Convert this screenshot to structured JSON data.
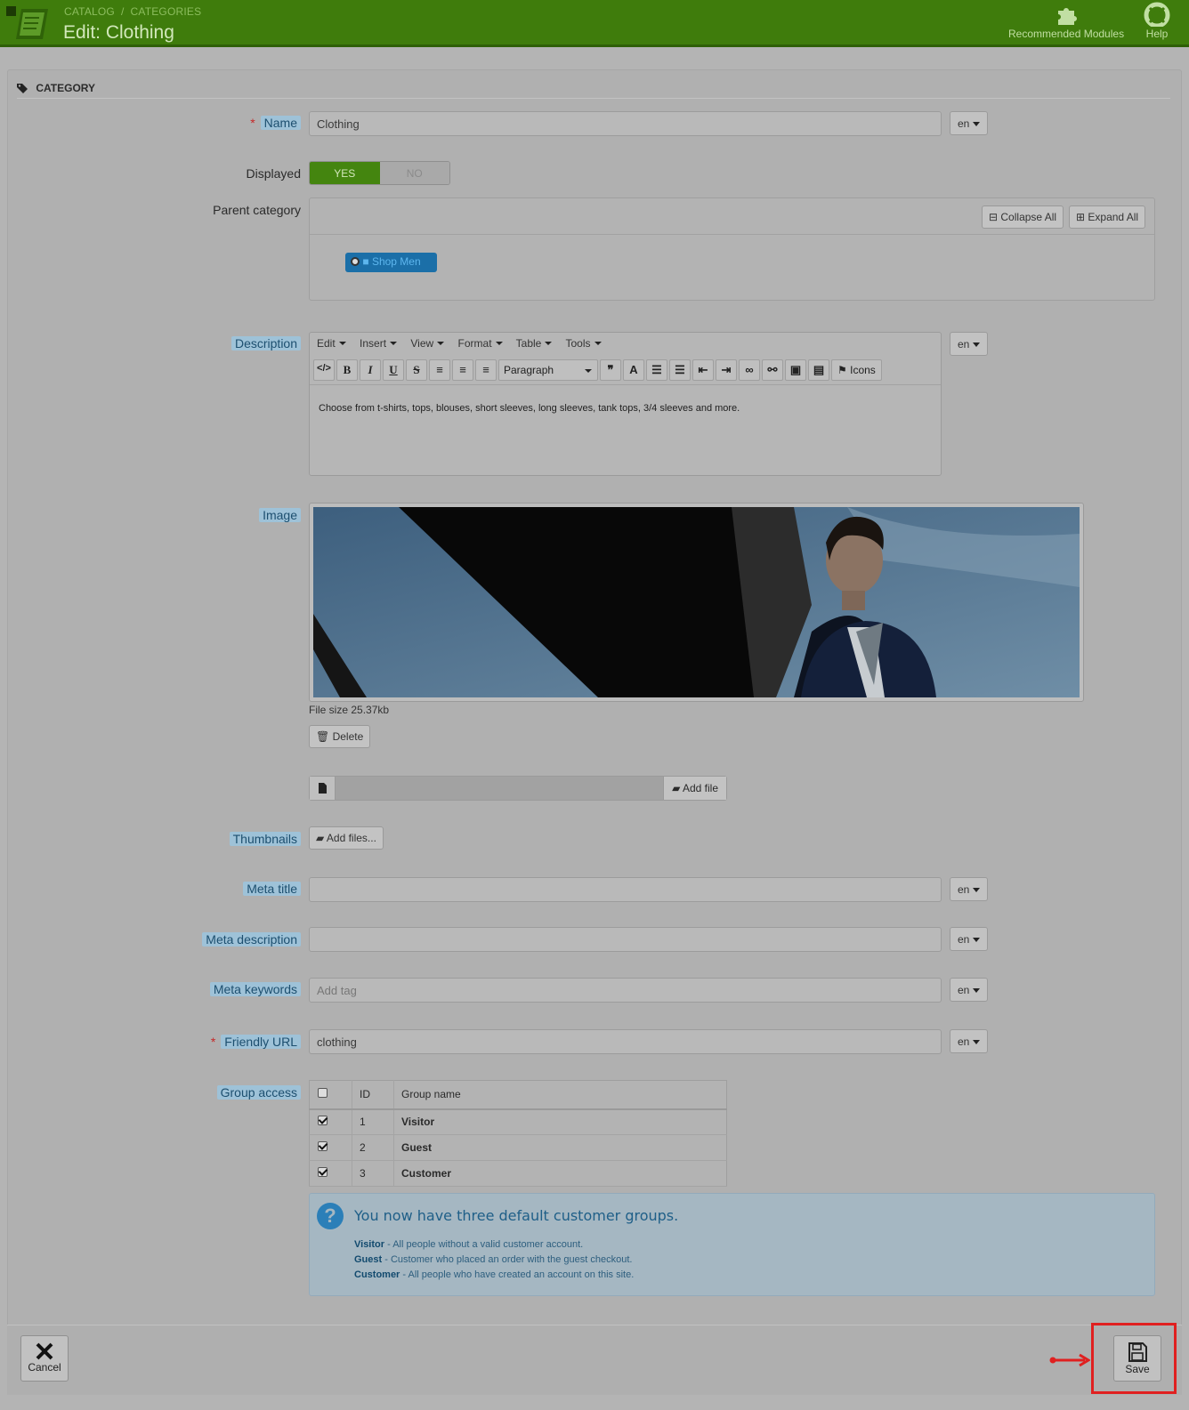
{
  "header": {
    "breadcrumb": [
      "CATALOG",
      "CATEGORIES"
    ],
    "breadcrumb_sep": "/",
    "title": "Edit: Clothing",
    "recommended_label": "Recommended Modules",
    "help_label": "Help"
  },
  "panel": {
    "heading": "CATEGORY"
  },
  "form": {
    "name": {
      "label": "Name",
      "value": "Clothing",
      "lang": "en"
    },
    "displayed": {
      "label": "Displayed",
      "yes": "YES",
      "no": "NO",
      "value": true
    },
    "parent": {
      "label": "Parent category",
      "collapse": "Collapse All",
      "expand": "Expand All",
      "node": "Shop Men"
    },
    "description": {
      "label": "Description",
      "lang": "en",
      "menus": [
        "Edit",
        "Insert",
        "View",
        "Format",
        "Table",
        "Tools"
      ],
      "format_select": "Paragraph",
      "icons_btn": "Icons",
      "content": "Choose from t-shirts, tops, blouses, short sleeves, long sleeves, tank tops, 3/4 sleeves and more."
    },
    "image": {
      "label": "Image",
      "file_size": "File size 25.37kb",
      "delete": "Delete",
      "add_file": "Add file"
    },
    "thumbnails": {
      "label": "Thumbnails",
      "add_files": "Add files..."
    },
    "meta_title": {
      "label": "Meta title",
      "value": "",
      "lang": "en"
    },
    "meta_description": {
      "label": "Meta description",
      "value": "",
      "lang": "en"
    },
    "meta_keywords": {
      "label": "Meta keywords",
      "placeholder": "Add tag",
      "lang": "en"
    },
    "friendly_url": {
      "label": "Friendly URL",
      "value": "clothing",
      "lang": "en"
    },
    "group_access": {
      "label": "Group access",
      "headers": {
        "id": "ID",
        "name": "Group name"
      },
      "rows": [
        {
          "id": "1",
          "name": "Visitor",
          "checked": true
        },
        {
          "id": "2",
          "name": "Guest",
          "checked": true
        },
        {
          "id": "3",
          "name": "Customer",
          "checked": true
        }
      ]
    },
    "help": {
      "heading": "You now have three default customer groups.",
      "lines": [
        {
          "term": "Visitor",
          "text": " - All people without a valid customer account."
        },
        {
          "term": "Guest",
          "text": " - Customer who placed an order with the guest checkout."
        },
        {
          "term": "Customer",
          "text": " - All people who have created an account on this site."
        }
      ]
    }
  },
  "footer": {
    "cancel": "Cancel",
    "save": "Save"
  },
  "colors": {
    "header_green": "#3f7c0c",
    "highlight": "#e02020",
    "accent_blue": "#1b6fa8"
  }
}
